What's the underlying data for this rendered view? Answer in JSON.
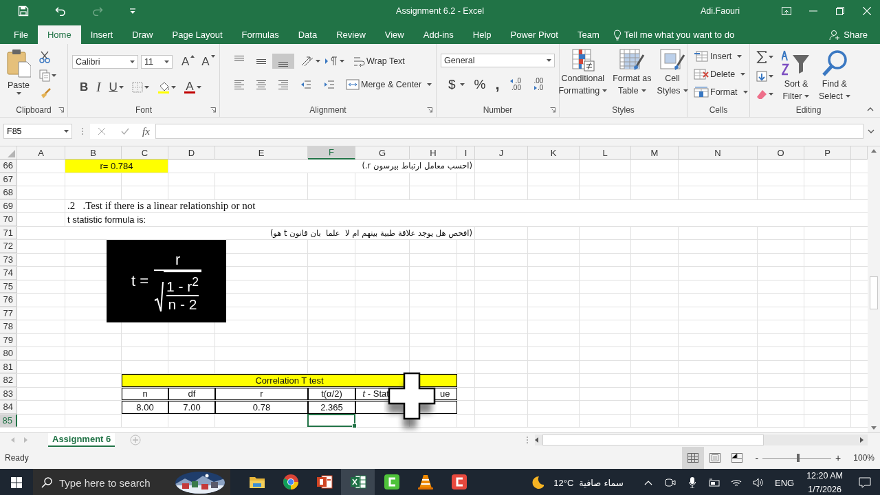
{
  "window": {
    "title": "Assignment 6.2  -  Excel",
    "user": "Adi.Faouri"
  },
  "quick_access": [
    {
      "kind": "save",
      "disabled": false
    },
    {
      "kind": "undo",
      "disabled": false
    },
    {
      "kind": "redo",
      "disabled": true
    },
    {
      "kind": "customize",
      "disabled": false
    }
  ],
  "ribbon_tabs": [
    {
      "label": "File",
      "selected": false
    },
    {
      "label": "Home",
      "selected": true
    },
    {
      "label": "Insert",
      "selected": false
    },
    {
      "label": "Draw",
      "selected": false
    },
    {
      "label": "Page Layout",
      "selected": false
    },
    {
      "label": "Formulas",
      "selected": false
    },
    {
      "label": "Data",
      "selected": false
    },
    {
      "label": "Review",
      "selected": false
    },
    {
      "label": "View",
      "selected": false
    },
    {
      "label": "Add-ins",
      "selected": false
    },
    {
      "label": "Help",
      "selected": false
    },
    {
      "label": "Power Pivot",
      "selected": false
    },
    {
      "label": "Team",
      "selected": false
    }
  ],
  "tell_me": {
    "placeholder": "Tell me what you want to do"
  },
  "share": {
    "label": "Share"
  },
  "ribbon": {
    "clipboard": {
      "label": "Clipboard",
      "paste": "Paste"
    },
    "font": {
      "label": "Font",
      "font_name": "Calibri",
      "font_size": "11",
      "grow": "A",
      "shrink": "A",
      "bold": "B",
      "italic": "I",
      "underline": "U",
      "font_color": "A"
    },
    "alignment": {
      "label": "Alignment",
      "buttons": [
        {
          "kind": "top",
          "selected": false
        },
        {
          "kind": "middle",
          "selected": false
        },
        {
          "kind": "bottom",
          "selected": true
        },
        {
          "kind": "left",
          "selected": false
        },
        {
          "kind": "center",
          "selected": false
        },
        {
          "kind": "right",
          "selected": false
        }
      ],
      "wrap_text": "Wrap Text",
      "merge": "Merge & Center"
    },
    "number": {
      "label": "Number",
      "format": "General",
      "currency": "$",
      "percent": "%",
      "comma": ",",
      "increase_decimal": [
        ".0",
        ".00"
      ],
      "decrease_decimal": [
        ".00",
        ".0"
      ]
    },
    "styles": {
      "label": "Styles",
      "items": [
        {
          "kind": "conditional",
          "lines": [
            "Conditional",
            "Formatting"
          ]
        },
        {
          "kind": "table",
          "lines": [
            "Format as",
            "Table"
          ]
        },
        {
          "kind": "cell",
          "lines": [
            "Cell",
            "Styles"
          ]
        }
      ]
    },
    "cells": {
      "label": "Cells",
      "items": [
        {
          "kind": "insert",
          "label": "Insert"
        },
        {
          "kind": "delete",
          "label": "Delete"
        },
        {
          "kind": "format",
          "label": "Format"
        }
      ]
    },
    "editing": {
      "label": "Editing",
      "items": [
        {
          "kind": "sort",
          "lines": [
            "Sort &",
            "Filter"
          ]
        },
        {
          "kind": "find",
          "lines": [
            "Find &",
            "Select"
          ]
        }
      ]
    }
  },
  "formula_bar": {
    "name_box": "F85",
    "function_label": "fx"
  },
  "sheet": {
    "columns": [
      {
        "label": "A",
        "selected": false
      },
      {
        "label": "B",
        "selected": false
      },
      {
        "label": "C",
        "selected": false
      },
      {
        "label": "D",
        "selected": false
      },
      {
        "label": "E",
        "selected": false
      },
      {
        "label": "F",
        "selected": true
      },
      {
        "label": "G",
        "selected": false
      },
      {
        "label": "H",
        "selected": false
      },
      {
        "label": "I",
        "selected": false
      },
      {
        "label": "J",
        "selected": false
      },
      {
        "label": "K",
        "selected": false
      },
      {
        "label": "L",
        "selected": false
      },
      {
        "label": "M",
        "selected": false
      },
      {
        "label": "N",
        "selected": false
      },
      {
        "label": "O",
        "selected": false
      },
      {
        "label": "P",
        "selected": false
      }
    ],
    "rows": [
      {
        "number": "66",
        "selected": false,
        "cells": {
          "B": {
            "kind": "highlight",
            "text": "r= 0.784"
          },
          "C": {
            "kind": "merged"
          },
          "I": {
            "kind": "rtl",
            "text": "(احسب معامل ارتباط بيرسون r.)"
          }
        }
      },
      {
        "number": "67",
        "selected": false
      },
      {
        "number": "68",
        "selected": false
      },
      {
        "number": "69",
        "selected": false,
        "cells": {
          "B": {
            "kind": "serif",
            "text": ".2   .Test if there is a linear relationship or not"
          }
        }
      },
      {
        "number": "70",
        "selected": false,
        "cells": {
          "B": {
            "kind": "plain",
            "text": "t statistic formula is:"
          }
        }
      },
      {
        "number": "71",
        "selected": false,
        "cells": {
          "I": {
            "kind": "rtl",
            "text": "(افحص هل يوجد علاقة طبية بينهم ام لا  علما  بان قانون t هو)"
          }
        }
      },
      {
        "number": "72",
        "selected": false
      },
      {
        "number": "73",
        "selected": false
      },
      {
        "number": "74",
        "selected": false
      },
      {
        "number": "75",
        "selected": false
      },
      {
        "number": "76",
        "selected": false
      },
      {
        "number": "77",
        "selected": false
      },
      {
        "number": "78",
        "selected": false
      },
      {
        "number": "79",
        "selected": false
      },
      {
        "number": "80",
        "selected": false
      },
      {
        "number": "81",
        "selected": false
      },
      {
        "number": "82",
        "selected": false,
        "cells": {
          "C": {
            "kind": "table_title",
            "text": "Correlation T test"
          },
          "D": {
            "kind": "merged"
          },
          "E": {
            "kind": "merged"
          },
          "F": {
            "kind": "merged"
          },
          "G": {
            "kind": "merged"
          },
          "H": {
            "kind": "merged"
          }
        }
      },
      {
        "number": "83",
        "selected": false,
        "cells": {
          "C": {
            "kind": "table",
            "text": "n"
          },
          "D": {
            "kind": "table",
            "text": "df"
          },
          "E": {
            "kind": "table",
            "text": "r"
          },
          "F": {
            "kind": "table",
            "text": "t(α/2)"
          },
          "G": {
            "kind": "table",
            "text": "*t* - Stat",
            "text_end": "ue"
          },
          "H": {
            "kind": "merged"
          }
        }
      },
      {
        "number": "84",
        "selected": false,
        "cells": {
          "C": {
            "kind": "table",
            "text": "8.00"
          },
          "D": {
            "kind": "table",
            "text": "7.00"
          },
          "E": {
            "kind": "table",
            "text": "0.78"
          },
          "F": {
            "kind": "table",
            "text": "2.365"
          },
          "G": {
            "kind": "table"
          },
          "H": {
            "kind": "merged"
          }
        }
      },
      {
        "number": "85",
        "selected": true,
        "cells": {
          "F": {
            "kind": "active"
          }
        }
      }
    ],
    "formula_image": {
      "lhs": "t =",
      "numerator": "r",
      "radicand_numerator": "1 - r$^{2}$",
      "radicand_denominator": "n - 2"
    }
  },
  "sheet_tabs": [
    {
      "label": "Assignment 6",
      "selected": true
    }
  ],
  "status_bar": {
    "text": "Ready",
    "views": [
      {
        "kind": "normal",
        "selected": true
      },
      {
        "kind": "page_layout",
        "selected": false
      },
      {
        "kind": "page_break",
        "selected": false
      }
    ],
    "zoom": {
      "out": "-",
      "in": "+",
      "level": 0.52,
      "reading": "100%"
    }
  },
  "taskbar": {
    "search": {
      "placeholder": "Type here to search"
    },
    "apps": [
      {
        "kind": "explorer",
        "active": false
      },
      {
        "kind": "chrome",
        "active": false
      },
      {
        "kind": "powerpoint",
        "active": false
      },
      {
        "kind": "excel",
        "active": true
      },
      {
        "kind": "camtasia",
        "active": false
      },
      {
        "kind": "vlc",
        "active": false
      },
      {
        "kind": "camtasia_recorder",
        "active": false
      }
    ],
    "weather": {
      "temperature": "12°C",
      "condition": "سماء صافية"
    },
    "language": "ENG",
    "time": "12:20 AM",
    "date": "1/7/2026"
  }
}
